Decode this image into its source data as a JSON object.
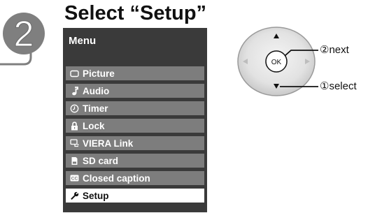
{
  "step": {
    "number": "2",
    "title": "Select “Setup”"
  },
  "menu": {
    "title": "Menu",
    "items": [
      {
        "label": "Picture",
        "icon": "picture-icon",
        "selected": false
      },
      {
        "label": "Audio",
        "icon": "music-note-icon",
        "selected": false
      },
      {
        "label": "Timer",
        "icon": "clock-icon",
        "selected": false
      },
      {
        "label": "Lock",
        "icon": "padlock-icon",
        "selected": false
      },
      {
        "label": "VIERA Link",
        "icon": "viera-link-icon",
        "selected": false
      },
      {
        "label": "SD card",
        "icon": "sd-card-icon",
        "selected": false
      },
      {
        "label": "Closed caption",
        "icon": "closed-caption-icon",
        "selected": false
      },
      {
        "label": "Setup",
        "icon": "wrench-icon",
        "selected": true
      }
    ]
  },
  "remote": {
    "ok_label": "OK",
    "next_label": "②next",
    "select_label": "①select"
  },
  "colors": {
    "badge_fill": "#7f7f7f",
    "menu_background": "#3a3a3a",
    "menu_item": "#7d7d7d",
    "menu_item_selected": "#ffffff"
  }
}
